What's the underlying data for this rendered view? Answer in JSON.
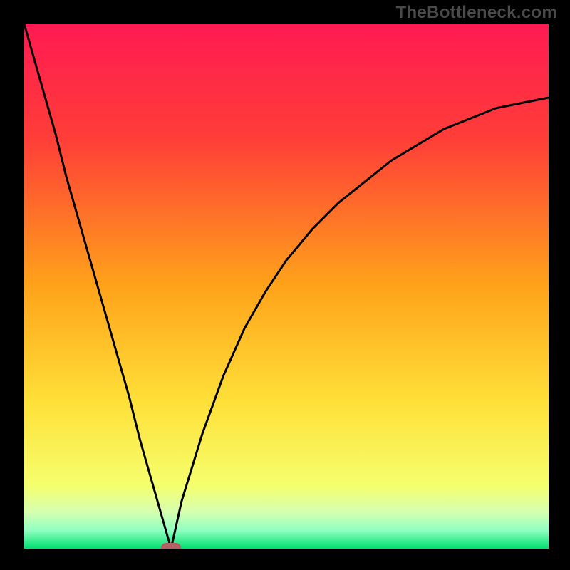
{
  "attribution": "TheBottleneck.com",
  "chart_data": {
    "type": "line",
    "title": "",
    "xlabel": "",
    "ylabel": "",
    "xlim": [
      0,
      100
    ],
    "ylim": [
      0,
      100
    ],
    "grid": false,
    "legend": false,
    "vertex_x": 28,
    "marker": {
      "x": 28,
      "y": 0,
      "color": "#b36063"
    },
    "series": [
      {
        "name": "left",
        "x": [
          0,
          2,
          4,
          6,
          8,
          10,
          12,
          14,
          16,
          18,
          20,
          22,
          24,
          26,
          28
        ],
        "y": [
          100,
          93,
          86,
          79,
          71,
          64,
          57,
          50,
          43,
          36,
          29,
          21,
          14,
          7,
          0
        ]
      },
      {
        "name": "right",
        "x": [
          28,
          30,
          34,
          38,
          42,
          46,
          50,
          55,
          60,
          65,
          70,
          75,
          80,
          85,
          90,
          95,
          100
        ],
        "y": [
          0,
          9,
          22,
          33,
          42,
          49,
          55,
          61,
          66,
          70,
          74,
          77,
          80,
          82,
          84,
          85,
          86
        ]
      }
    ],
    "background_gradient": {
      "stops": [
        {
          "offset": 0.0,
          "color": "#ff1a52"
        },
        {
          "offset": 0.22,
          "color": "#ff3e38"
        },
        {
          "offset": 0.5,
          "color": "#ffa31a"
        },
        {
          "offset": 0.72,
          "color": "#ffe038"
        },
        {
          "offset": 0.88,
          "color": "#f5ff6e"
        },
        {
          "offset": 0.93,
          "color": "#d6ffb0"
        },
        {
          "offset": 0.965,
          "color": "#8fffc0"
        },
        {
          "offset": 1.0,
          "color": "#00e070"
        }
      ]
    }
  }
}
